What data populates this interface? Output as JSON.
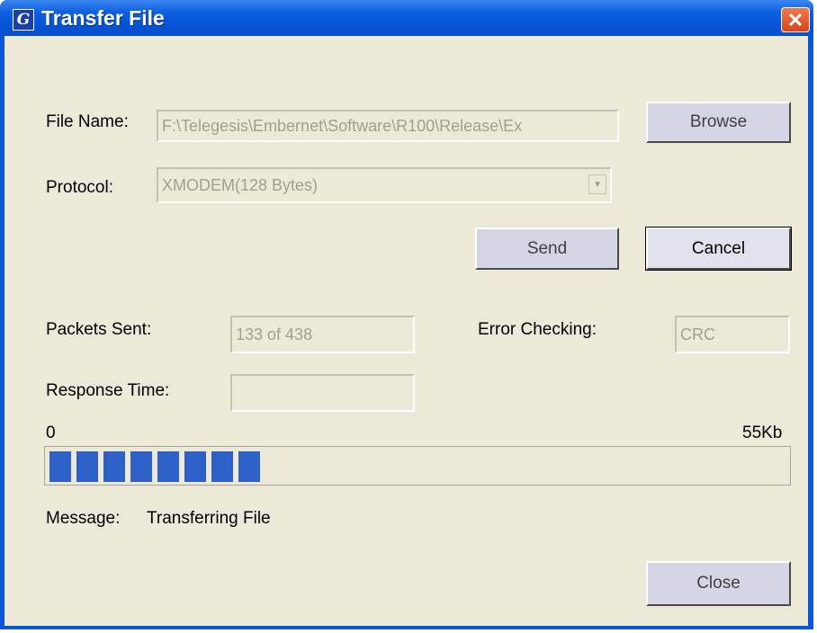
{
  "window": {
    "title": "Transfer File",
    "app_icon_glyph": "G",
    "close_glyph": "✕"
  },
  "fields": {
    "file_name_label": "File Name:",
    "file_name_value": "F:\\Telegesis\\Embernet\\Software\\R100\\Release\\Ex",
    "protocol_label": "Protocol:",
    "protocol_value": "XMODEM(128 Bytes)",
    "protocol_arrow": "▾",
    "packets_sent_label": "Packets Sent:",
    "packets_sent_value": "133 of 438",
    "error_checking_label": "Error Checking:",
    "error_checking_value": "CRC",
    "response_time_label": "Response Time:",
    "response_time_value": ""
  },
  "buttons": {
    "browse": "Browse",
    "send": "Send",
    "cancel": "Cancel",
    "close": "Close"
  },
  "progress": {
    "min_label": "0",
    "max_label": "55Kb",
    "fraction": 0.31,
    "color": "#2e61c8"
  },
  "message": {
    "label": "Message:",
    "value": "Transferring File"
  }
}
